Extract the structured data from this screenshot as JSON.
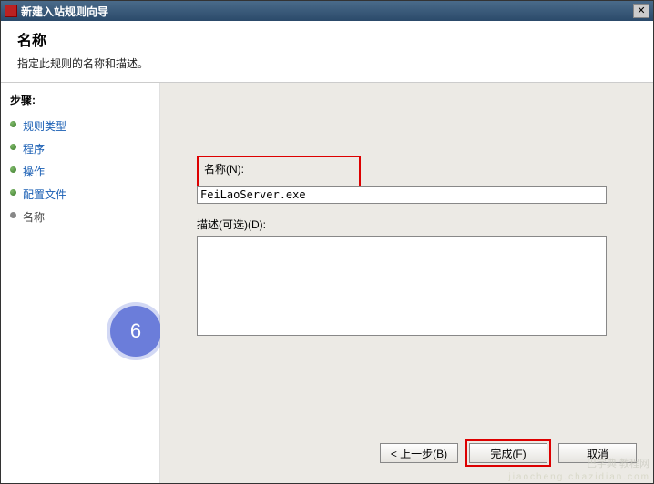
{
  "window": {
    "title": "新建入站规则向导",
    "close_label": "✕"
  },
  "header": {
    "title": "名称",
    "subtitle": "指定此规则的名称和描述。"
  },
  "sidebar": {
    "title": "步骤:",
    "steps": {
      "rule_type": "规则类型",
      "program": "程序",
      "action": "操作",
      "profile": "配置文件",
      "name": "名称"
    }
  },
  "form": {
    "name_label": "名称(N):",
    "name_value": "FeiLaoServer.exe",
    "desc_label": "描述(可选)(D):",
    "desc_value": ""
  },
  "buttons": {
    "back": "< 上一步(B)",
    "finish": "完成(F)",
    "cancel": "取消"
  },
  "annotation": {
    "badge": "6"
  },
  "watermark": {
    "line1": "巴字典 教程网",
    "line2": "jiaocheng.chazidian.com"
  }
}
